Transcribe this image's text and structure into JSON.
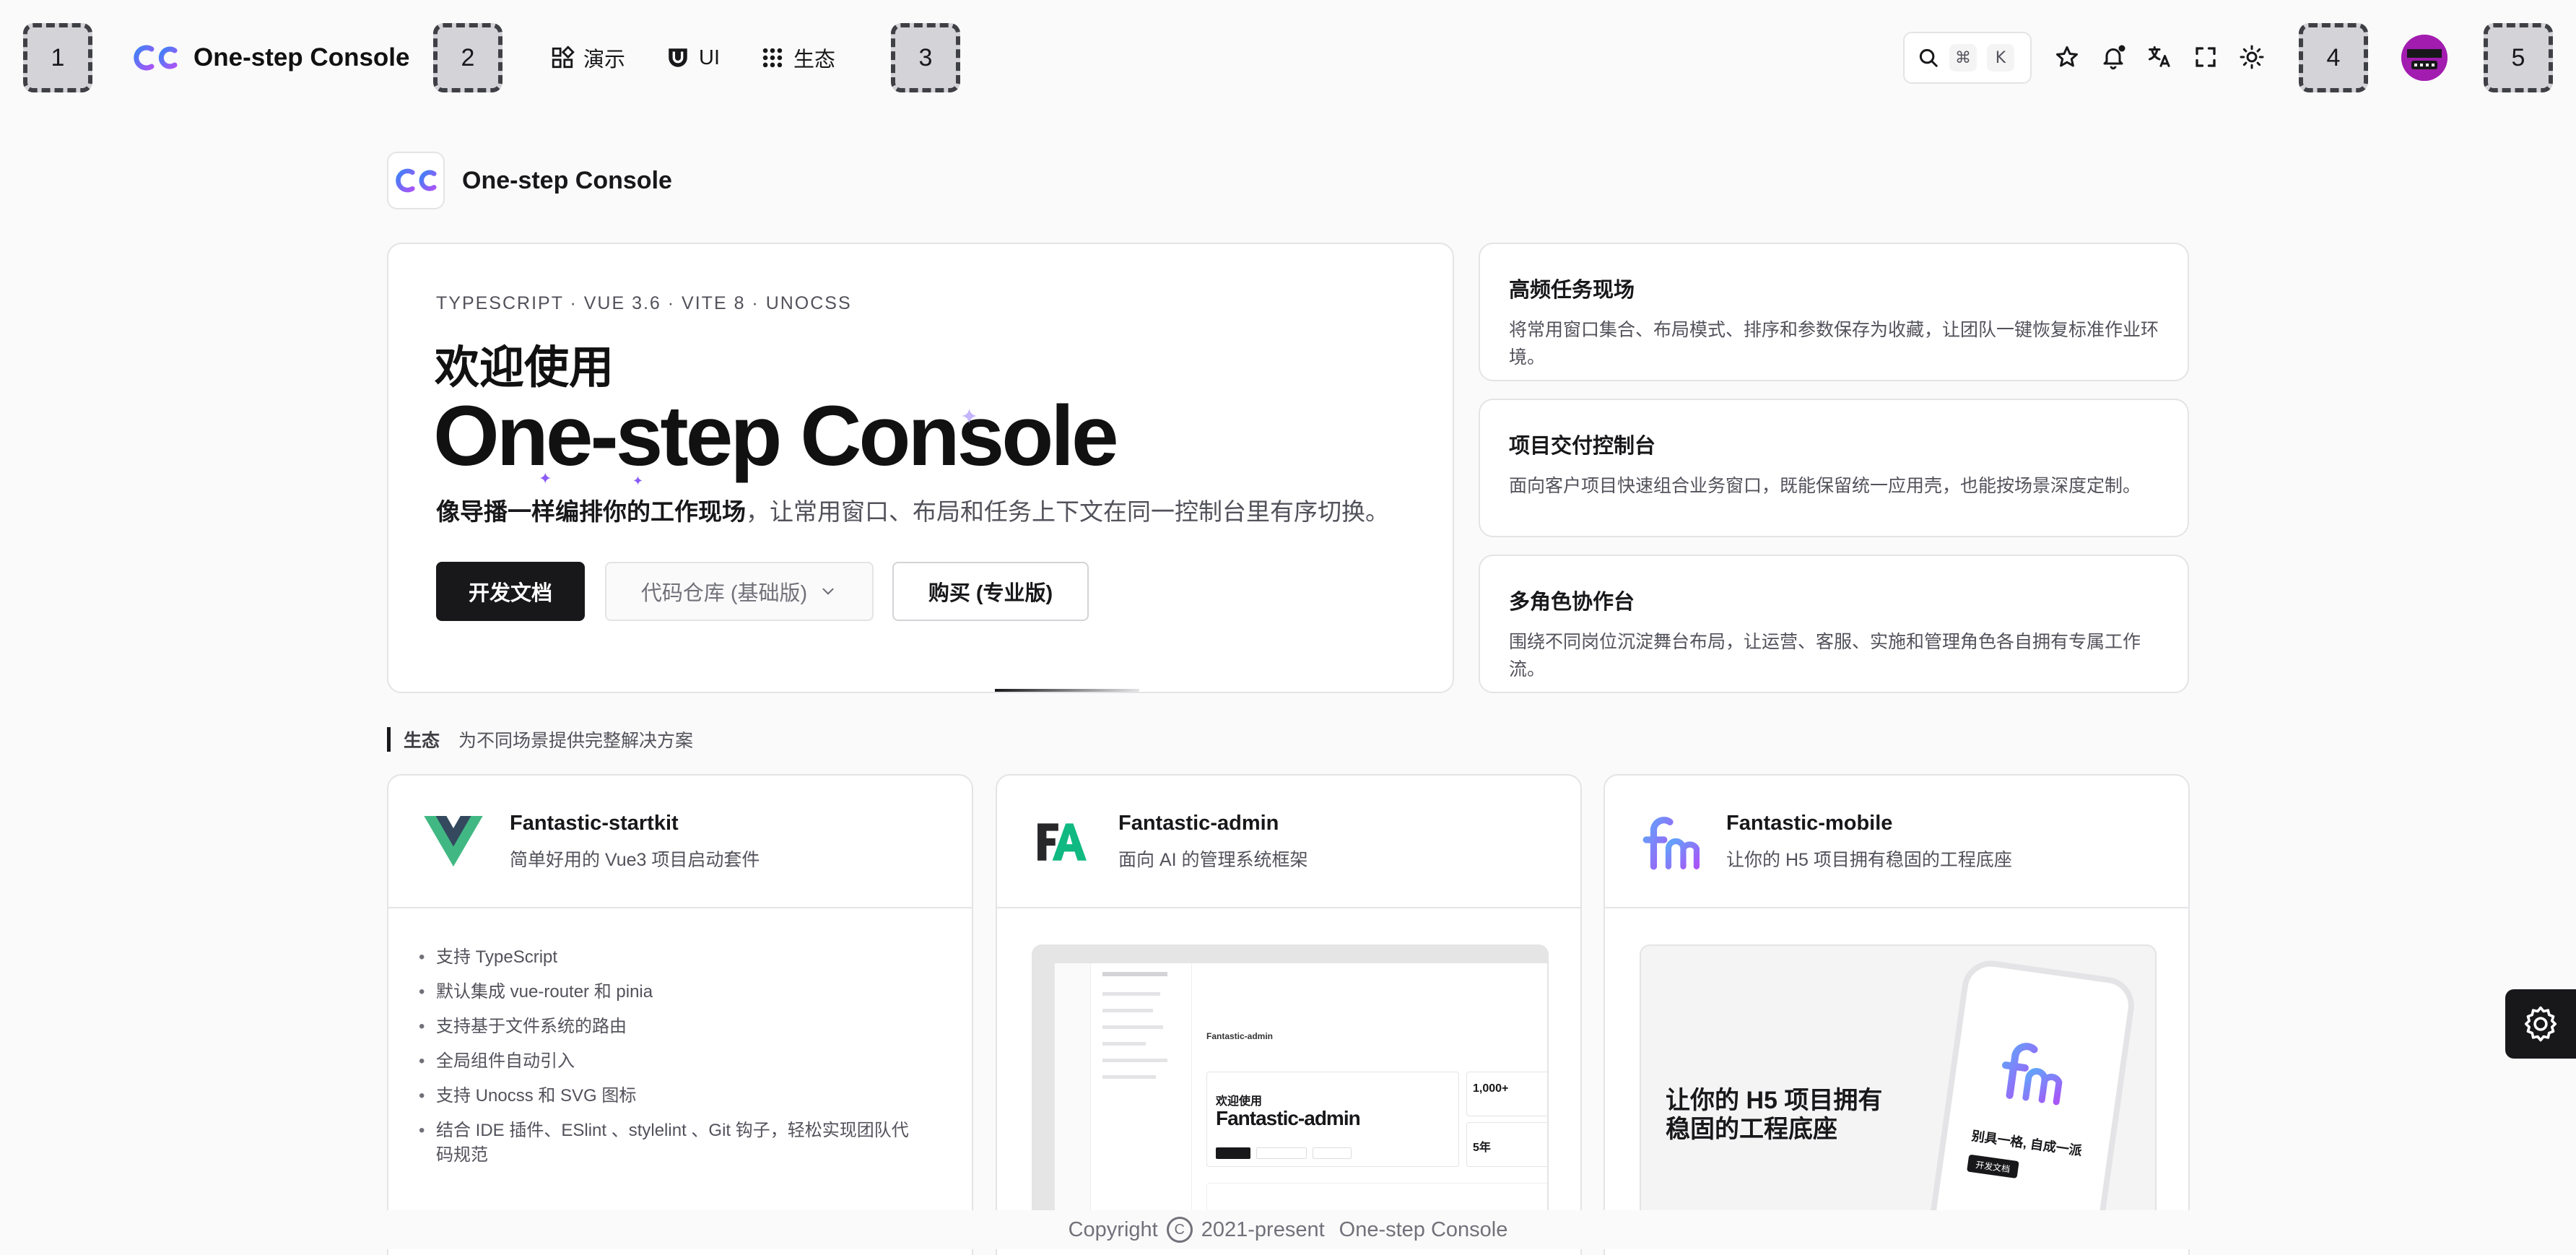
{
  "header": {
    "slots": [
      "1",
      "2",
      "3",
      "4",
      "5"
    ],
    "brand_title": "One-step Console",
    "nav": [
      {
        "label": "演示",
        "icon": "grid-icon"
      },
      {
        "label": "UI",
        "icon": "ui-shield-icon"
      },
      {
        "label": "生态",
        "icon": "dots-grid-icon"
      }
    ],
    "search_keys": [
      "⌘",
      "K"
    ],
    "icons": [
      "star-icon",
      "bell-icon",
      "translate-icon",
      "fullscreen-icon",
      "sun-icon"
    ]
  },
  "page": {
    "brand_title": "One-step Console"
  },
  "hero": {
    "tag": "TYPESCRIPT · VUE 3.6 · VITE 8 · UNOCSS",
    "welcome": "欢迎使用",
    "title": "One-step Console",
    "desc_bold": "像导播一样编排你的工作现场",
    "desc_rest": "，让常用窗口、布局和任务上下文在同一控制台里有序切换。",
    "btn_docs": "开发文档",
    "btn_repo": "代码仓库 (基础版)",
    "btn_buy": "购买 (专业版)"
  },
  "features": [
    {
      "title": "高频任务现场",
      "desc": "将常用窗口集合、布局模式、排序和参数保存为收藏，让团队一键恢复标准作业环境。"
    },
    {
      "title": "项目交付控制台",
      "desc": "面向客户项目快速组合业务窗口，既能保留统一应用壳，也能按场景深度定制。"
    },
    {
      "title": "多角色协作台",
      "desc": "围绕不同岗位沉淀舞台布局，让运营、客服、实施和管理角色各自拥有专属工作流。"
    }
  ],
  "section": {
    "title": "生态",
    "desc": "为不同场景提供完整解决方案"
  },
  "ecosystem": [
    {
      "name": "Fantastic-startkit",
      "sub": "简单好用的 Vue3 项目启动套件",
      "items": [
        "支持 TypeScript",
        "默认集成 vue-router 和 pinia",
        "支持基于文件系统的路由",
        "全局组件自动引入",
        "支持 Unocss 和 SVG 图标",
        "结合 IDE 插件、ESlint 、stylelint 、Git 钩子，轻松实现团队代码规范"
      ]
    },
    {
      "name": "Fantastic-admin",
      "sub": "面向 AI 的管理系统框架",
      "shot_welcome": "欢迎使用",
      "shot_title": "Fantastic-admin",
      "shot_brand": "Fantastic-admin",
      "shot_stat1": "1,000+",
      "shot_stat2": "5年"
    },
    {
      "name": "Fantastic-mobile",
      "sub": "让你的 H5 项目拥有稳固的工程底座",
      "shot_title_line1": "让你的 H5 项目拥有",
      "shot_title_line2": "稳固的工程底座",
      "shot_slogan": "别具一格, 自成一派",
      "shot_btn": "开发文档"
    }
  ],
  "footer": {
    "copyright": "Copyright",
    "year": "2021-present",
    "name": "One-step Console"
  },
  "colors": {
    "accent_purple": "#8b5cf6",
    "logo_blue": "#3b82f6",
    "vue_green": "#41b883",
    "dark": "#18181b"
  }
}
